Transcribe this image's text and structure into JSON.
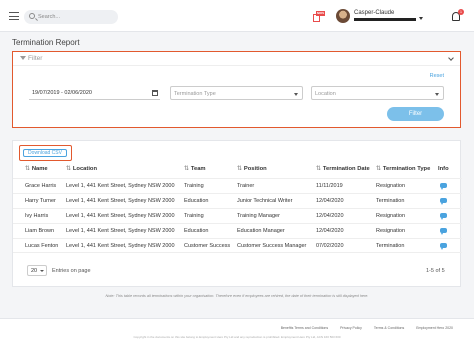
{
  "header": {
    "search_placeholder": "Search...",
    "user_name": "Casper-Claude",
    "notification_count": "1",
    "badge_text": "NDIS"
  },
  "page": {
    "title": "Termination Report"
  },
  "filter": {
    "title": "Filter",
    "reset_label": "Reset",
    "date_range": "19/07/2019 - 02/06/2020",
    "termination_type_placeholder": "Termination Type",
    "location_placeholder": "Location",
    "filter_button": "Filter"
  },
  "table": {
    "download_csv_label": "Download CSV",
    "columns": [
      "Name",
      "Location",
      "Team",
      "Position",
      "Termination Date",
      "Termination Type",
      "Info"
    ],
    "rows": [
      {
        "name": "Grace Harris",
        "location": "Level 1, 441 Kent Street, Sydney NSW 2000",
        "team": "Training",
        "position": "Trainer",
        "date": "11/11/2019",
        "type": "Resignation"
      },
      {
        "name": "Harry Turner",
        "location": "Level 1, 441 Kent Street, Sydney NSW 2000",
        "team": "Education",
        "position": "Junior Technical Writer",
        "date": "12/04/2020",
        "type": "Termination"
      },
      {
        "name": "Ivy Harris",
        "location": "Level 1, 441 Kent Street, Sydney NSW 2000",
        "team": "Training",
        "position": "Training Manager",
        "date": "12/04/2020",
        "type": "Resignation"
      },
      {
        "name": "Liam Brown",
        "location": "Level 1, 441 Kent Street, Sydney NSW 2000",
        "team": "Education",
        "position": "Education Manager",
        "date": "12/04/2020",
        "type": "Resignation"
      },
      {
        "name": "Lucas Fenton",
        "location": "Level 1, 441 Kent Street, Sydney NSW 2000",
        "team": "Customer Success",
        "position": "Customer Success Manager",
        "date": "07/02/2020",
        "type": "Termination"
      }
    ],
    "page_size": "20",
    "page_size_label": "Entries on page",
    "count_label": "1-5 of 5"
  },
  "note": "Note: This table records all terminations within your organisation. Therefore even if employees are rehired, the date of their termination is still displayed here.",
  "footer": {
    "links": [
      "Benefits Terms and Conditions",
      "Privacy Policy",
      "Terms & Conditions",
      "Employment Hero 2020"
    ],
    "copyright": "Copyright in the documents on this site belong to Employment Hero Pty Ltd and any reproduction is prohibited. Employment Hero Pty Ltd, ACN 160 563 600"
  }
}
